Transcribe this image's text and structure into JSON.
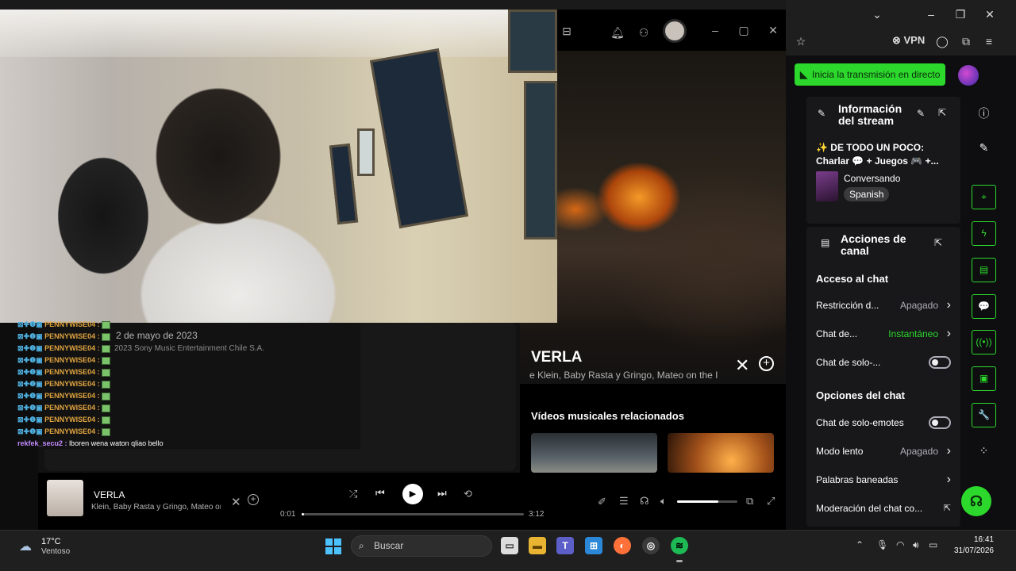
{
  "browser": {
    "vpn_label": "VPN",
    "window_controls": [
      "chevron-down",
      "minimize",
      "restore",
      "close"
    ]
  },
  "twitch": {
    "go_live_label": "Inicia la transmisión en directo",
    "stream_info": {
      "title": "Información del stream",
      "stream_title": "✨ DE TODO UN POCO: Charlar 💬 + Juegos 🎮 +...",
      "category": "Conversando",
      "language": "Spanish"
    },
    "channel_actions": {
      "title": "Acciones de canal",
      "chat_access_heading": "Acceso al chat",
      "rows_access": [
        {
          "label": "Restricción d...",
          "value": "Apagado",
          "type": "select"
        },
        {
          "label": "Chat de...",
          "value": "Instantáneo",
          "type": "select",
          "accent": "#2cd82c"
        },
        {
          "label": "Chat de solo-...",
          "value": "",
          "type": "toggle",
          "on": false
        }
      ],
      "chat_options_heading": "Opciones del chat",
      "rows_options": [
        {
          "label": "Chat de solo-emotes",
          "value": "",
          "type": "toggle",
          "on": false
        },
        {
          "label": "Modo lento",
          "value": "Apagado",
          "type": "select"
        },
        {
          "label": "Palabras baneadas",
          "value": "",
          "type": "select"
        },
        {
          "label": "Moderación del chat co...",
          "value": "",
          "type": "link"
        }
      ]
    },
    "accent_color": "#2cd82c"
  },
  "spotify": {
    "album_release": "2 de mayo de 2023",
    "copyright": "2023 Sony Music Entertainment Chile S.A.",
    "now_playing_panel": {
      "title": "VERLA",
      "artists": "e Klein, Baby Rasta y Gringo, Mateo on the I",
      "related_heading": "Vídeos musicales relacionados"
    },
    "player": {
      "title": "VERLA",
      "artists": "Klein, Baby Rasta y Gringo, Mateo on",
      "current_time": "0:01",
      "duration": "3:12",
      "progress": 0.01,
      "volume": 0.68
    },
    "accent_color": "#1db954"
  },
  "chat": {
    "repeated_user": "PENNYWISE04 :",
    "repeat_count": 10,
    "last_user": "rekfek_secu2 :",
    "last_message": "lboren wena waton qliao bello"
  },
  "taskbar": {
    "weather_temp": "17°C",
    "weather_desc": "Ventoso",
    "search_placeholder": "Buscar",
    "clock_time": "16:41",
    "clock_date": "31/07/2026"
  }
}
